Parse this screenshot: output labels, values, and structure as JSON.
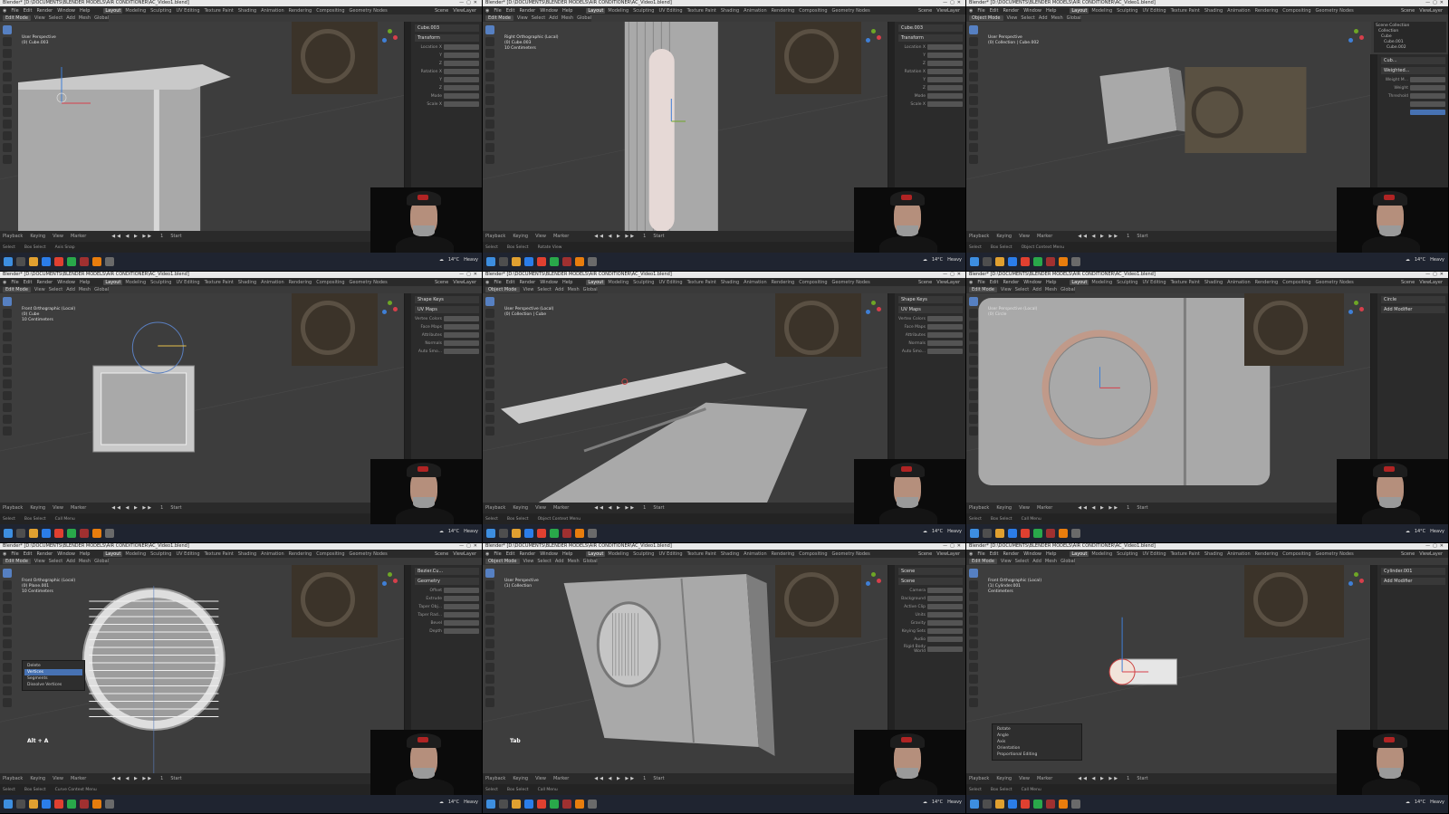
{
  "app": {
    "name": "Blender",
    "title_full": "Blender* [D:\\DOCUMENTS\\BLENDER MODELS\\AIR CONDITIONER\\AC_Video1.blend]",
    "menu": [
      "File",
      "Edit",
      "Render",
      "Window",
      "Help"
    ],
    "workspaces": [
      "Layout",
      "Modeling",
      "Sculpting",
      "UV Editing",
      "Texture Paint",
      "Shading",
      "Animation",
      "Rendering",
      "Compositing",
      "Geometry Nodes",
      "Scripting"
    ],
    "scene_label": "Scene",
    "view_layer_label": "ViewLayer"
  },
  "header_common": {
    "edit_mode": "Edit Mode",
    "object_mode": "Object Mode",
    "view": "View",
    "select": "Select",
    "add": "Add",
    "mesh": "Mesh",
    "object": "Object",
    "global": "Global"
  },
  "timeline": {
    "playback": "Playback",
    "keying": "Keying",
    "view": "View",
    "marker": "Marker",
    "start": "Start",
    "frame": "1"
  },
  "status": {
    "select": "Select",
    "box_select": "Box Select",
    "rotate_view": "Rotate View",
    "call_menu": "Call Menu",
    "object_context": "Object Context Menu"
  },
  "taskbar": {
    "temp": "14°C",
    "weather": "Heavy",
    "brand": "Udemy"
  },
  "panels": [
    {
      "vp_line1": "User Perspective",
      "vp_line2": "(0) Cube.003",
      "mode": "Edit Mode",
      "props_title": "Cube.003",
      "props_section": "Transform",
      "rows": [
        "Location X",
        "Y",
        "Z",
        "Rotation X",
        "Y",
        "Z",
        "Mode",
        "Scale X"
      ],
      "status_extra": "Axis Snap"
    },
    {
      "vp_line1": "Right Orthographic (Local)",
      "vp_line2": "(0) Cube.003",
      "vp_line3": "10 Centimeters",
      "mode": "Edit Mode",
      "props_title": "Cube.003",
      "props_section": "Transform",
      "rows": [
        "Location X",
        "Y",
        "Z",
        "Rotation X",
        "Y",
        "Z",
        "Mode",
        "Scale X"
      ],
      "status_extra": "Rotate View"
    },
    {
      "vp_line1": "User Perspective",
      "vp_line2": "(0) Collection | Cube.002",
      "mode": "Object Mode",
      "props_title": "Cub...",
      "props_section": "Weighted...",
      "rows": [
        "Weight M...",
        "Weight",
        "Threshold",
        "",
        ""
      ],
      "status_extra": "Object Context Menu",
      "outliner": [
        "Scene Collection",
        "Collection",
        "Cube",
        "Cube.001",
        "Cube.002"
      ]
    },
    {
      "vp_line1": "Front Orthographic (Local)",
      "vp_line2": "(0) Cube",
      "vp_line3": "10 Centimeters",
      "mode": "Edit Mode",
      "props_title": "Shape Keys",
      "props_section": "UV Maps",
      "rows": [
        "Vertex Colors",
        "Face Maps",
        "Attributes",
        "Normals",
        "Auto Smo..."
      ],
      "status_extra": "Call Menu"
    },
    {
      "vp_line1": "User Perspective (Local)",
      "vp_line2": "(0) Collection | Cube",
      "mode": "Object Mode",
      "props_title": "Shape Keys",
      "props_section": "UV Maps",
      "rows": [
        "Vertex Colors",
        "Face Maps",
        "Attributes",
        "Normals",
        "Auto Smo..."
      ],
      "status_extra": "Object Context Menu"
    },
    {
      "vp_line1": "User Perspective (Local)",
      "vp_line2": "(0) Circle",
      "mode": "Edit Mode",
      "props_title": "Circle",
      "props_section": "Add Modifier",
      "rows": [],
      "status_extra": "Call Menu"
    },
    {
      "vp_line1": "Front Orthographic (Local)",
      "vp_line2": "(0) Plane.001",
      "vp_line3": "10 Centimeters",
      "mode": "Edit Mode",
      "props_title": "Bezier.Cu...",
      "props_section": "Geometry",
      "rows": [
        "Offset",
        "Extrude",
        "Taper Obj...",
        "Taper Rad...",
        "Bevel",
        "Depth"
      ],
      "status_extra": "Curve Context Menu",
      "popup": [
        "Delete",
        "Vertices",
        "Segments",
        "Dissolve Vertices"
      ],
      "hint": "Alt + A"
    },
    {
      "vp_line1": "User Perspective",
      "vp_line2": "(1) Collection",
      "mode": "Object Mode",
      "props_title": "Scene",
      "props_section": "Scene",
      "rows": [
        "Camera",
        "Background",
        "Active Clip",
        "Units",
        "Gravity",
        "Keying Sets",
        "Audio",
        "Rigid Body World"
      ],
      "status_extra": "Call Menu",
      "hint": "Tab"
    },
    {
      "vp_line1": "Front Orthographic (Local)",
      "vp_line2": "(1) Cylinder.001",
      "vp_line3": "Centimeters",
      "mode": "Edit Mode",
      "props_title": "Cylinder.001",
      "props_section": "Add Modifier",
      "rows": [],
      "status_extra": "Call Menu",
      "popup": [
        "Rotate",
        "Angle",
        "Axis",
        "Orientation",
        "Proportional Editing"
      ]
    }
  ]
}
